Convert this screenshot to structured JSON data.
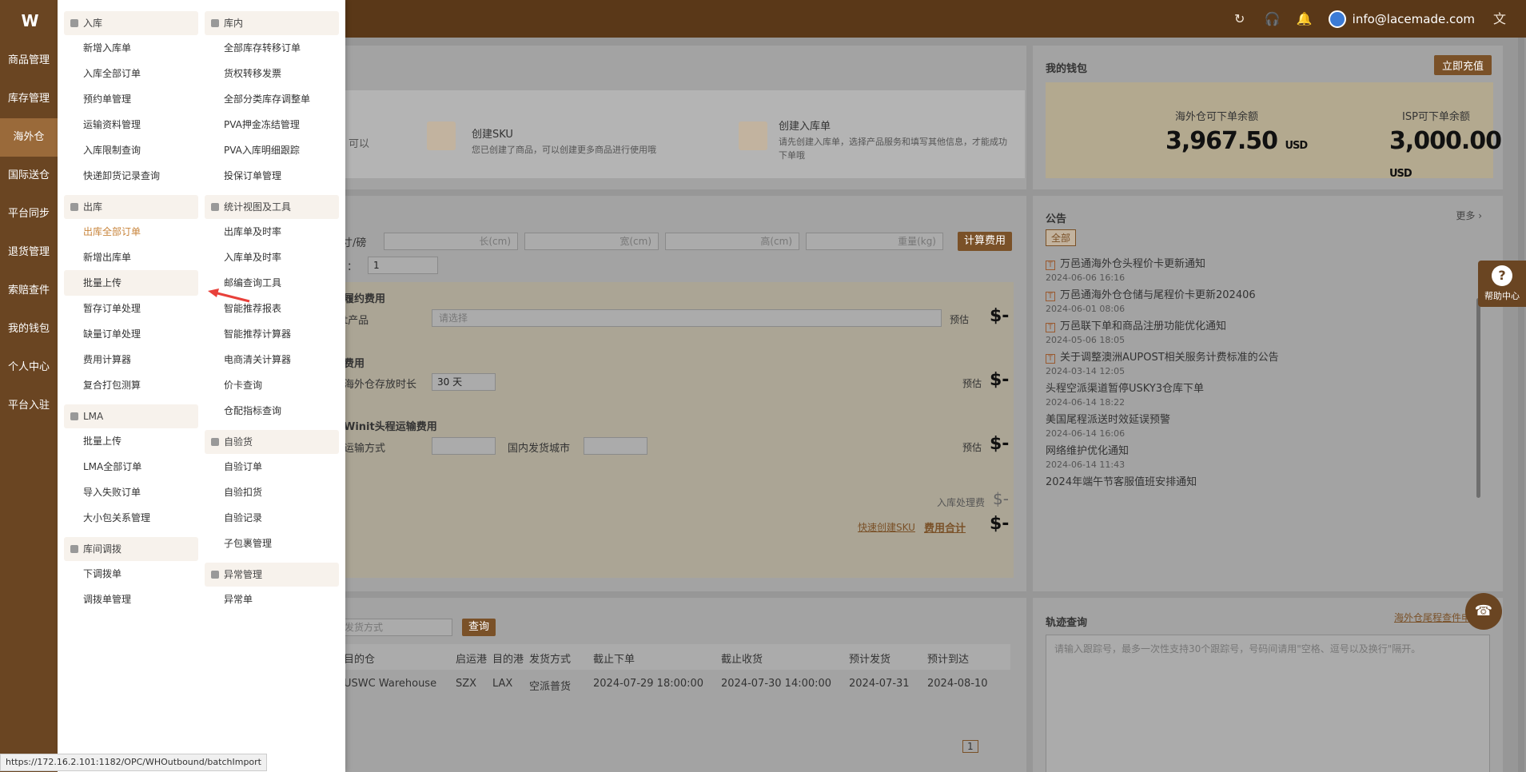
{
  "header": {
    "user_email": "info@lacemade.com",
    "icons": [
      "refresh-icon",
      "headset-icon",
      "bell-icon",
      "translate-icon"
    ]
  },
  "rail": {
    "logo": "W",
    "items": [
      {
        "label": "商品管理"
      },
      {
        "label": "库存管理"
      },
      {
        "label": "海外仓",
        "active": true
      },
      {
        "label": "国际送仓"
      },
      {
        "label": "平台同步"
      },
      {
        "label": "退货管理"
      },
      {
        "label": "索赔查件"
      },
      {
        "label": "我的钱包"
      },
      {
        "label": "个人中心"
      },
      {
        "label": "平台入驻"
      }
    ]
  },
  "menu": {
    "col1": [
      {
        "title": "入库",
        "items": [
          "新增入库单",
          "入库全部订单",
          "预约单管理",
          "运输资料管理",
          "入库限制查询",
          "快递卸货记录查询"
        ]
      },
      {
        "title": "出库",
        "items": [
          "出库全部订单",
          "新增出库单",
          "批量上传",
          "暂存订单处理",
          "缺量订单处理",
          "费用计算器",
          "复合打包测算"
        ]
      },
      {
        "title": "LMA",
        "items": [
          "批量上传",
          "LMA全部订单",
          "导入失败订单",
          "大小包关系管理"
        ]
      },
      {
        "title": "库间调拨",
        "items": [
          "下调拨单",
          "调拨单管理"
        ]
      }
    ],
    "col2": [
      {
        "title": "库内",
        "items": [
          "全部库存转移订单",
          "货权转移发票",
          "全部分类库存调整单",
          "PVA押金冻结管理",
          "PVA入库明细跟踪",
          "投保订单管理"
        ]
      },
      {
        "title": "统计视图及工具",
        "items": [
          "出库单及时率",
          "入库单及时率",
          "邮编查询工具",
          "智能推荐报表",
          "智能推荐计算器",
          "电商清关计算器",
          "价卡查询",
          "仓配指标查询"
        ]
      },
      {
        "title": "自验货",
        "items": [
          "自验订单",
          "自验扣货",
          "自验记录",
          "子包裹管理"
        ]
      },
      {
        "title": "异常管理",
        "items": [
          "异常单"
        ]
      }
    ],
    "selected": "出库全部订单",
    "hovered": "批量上传"
  },
  "steps": [
    {
      "label": "可以"
    },
    {
      "title": "创建SKU",
      "desc": "您已创建了商品，可以创建更多商品进行使用哦"
    },
    {
      "title": "创建入库单",
      "desc": "请先创建入库单，选择产品服务和填写其他信息，才能成功下单哦"
    }
  ],
  "wallet": {
    "title": "我的钱包",
    "recharge": "立即充值",
    "overseas_label": "海外仓可下单余额",
    "overseas_amount": "3,967.50",
    "isp_label": "ISP可下单余额",
    "isp_amount": "3,000.00",
    "currency": "USD"
  },
  "calc": {
    "unit": "寸/磅",
    "length_ph": "长(cm)",
    "width_ph": "宽(cm)",
    "height_ph": "高(cm)",
    "weight_ph": "重量(kg)",
    "calc_btn": "计算费用",
    "qty_label": "：",
    "qty_value": "1",
    "fulfil_title": "履约费用",
    "product_label": "t产品",
    "select_ph": "请选择",
    "estimate": "预估",
    "storage_title": "费用",
    "storage_label": "海外仓存放时长",
    "storage_value": "30 天",
    "head_title": "Winit头程运输费用",
    "transport_label": "运输方式",
    "city_label": "国内发货城市",
    "inbound_fee": "入库处理费",
    "quick_sku": "快速创建SKU",
    "total": "费用合计",
    "dollar": "$-"
  },
  "notices": {
    "title": "公告",
    "more": "更多",
    "tab_all": "全部",
    "items": [
      {
        "title": "万邑通海外仓头程价卡更新通知",
        "date": "2024-06-06 16:16",
        "tag": true
      },
      {
        "title": "万邑通海外仓仓储与尾程价卡更新202406",
        "date": "2024-06-01 08:06",
        "tag": true
      },
      {
        "title": "万邑联下单和商品注册功能优化通知",
        "date": "2024-05-06 18:05",
        "tag": true
      },
      {
        "title": "关于调整澳洲AUPOST相关服务计费标准的公告",
        "date": "2024-03-14 12:05",
        "tag": true
      },
      {
        "title": "头程空派渠道暂停USKY3仓库下单",
        "date": "2024-06-14 18:22",
        "tag": false
      },
      {
        "title": "美国尾程派送时效延误预警",
        "date": "2024-06-14 16:06",
        "tag": false
      },
      {
        "title": "网络维护优化通知",
        "date": "2024-06-14 11:43",
        "tag": false
      },
      {
        "title": "2024年端午节客服值班安排通知",
        "date": "",
        "tag": false
      }
    ]
  },
  "schedule": {
    "mode_ph": "发货方式",
    "query_btn": "查询",
    "headers": [
      "目的仓",
      "启运港",
      "目的港",
      "发货方式",
      "截止下单",
      "截止收货",
      "预计发货",
      "预计到达"
    ],
    "rows": [
      [
        "USWC Warehouse",
        "SZX",
        "LAX",
        "空派普货",
        "2024-07-29 18:00:00",
        "2024-07-30 14:00:00",
        "2024-07-31",
        "2024-08-10"
      ]
    ],
    "page": "1"
  },
  "track": {
    "title": "轨迹查询",
    "link": "海外仓尾程查件申请",
    "placeholder": "请输入跟踪号，最多一次性支持30个跟踪号，号码间请用\"空格、逗号以及换行\"隔开。"
  },
  "help": {
    "label": "帮助中心",
    "q": "?"
  },
  "status_url": "https://172.16.2.101:1182/OPC/WHOutbound/batchImport"
}
